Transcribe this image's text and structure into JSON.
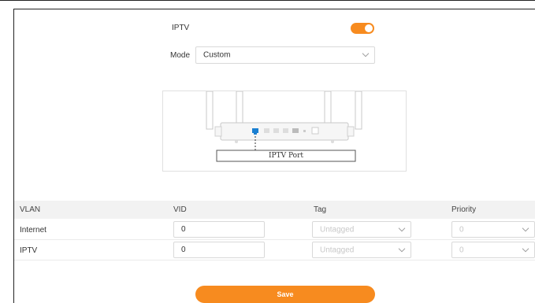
{
  "iptv": {
    "label": "IPTV",
    "enabled": true
  },
  "mode": {
    "label": "Mode",
    "value": "Custom"
  },
  "diagram": {
    "port_label": "IPTV Port"
  },
  "table": {
    "headers": [
      "VLAN",
      "VID",
      "Tag",
      "Priority"
    ],
    "rows": [
      {
        "vlan": "Internet",
        "vid": "0",
        "tag": "Untagged",
        "priority": "0"
      },
      {
        "vlan": "IPTV",
        "vid": "0",
        "tag": "Untagged",
        "priority": "0"
      }
    ]
  },
  "save_label": "Save",
  "colors": {
    "accent": "#f78b1f",
    "port_blue": "#1a7fd1"
  }
}
